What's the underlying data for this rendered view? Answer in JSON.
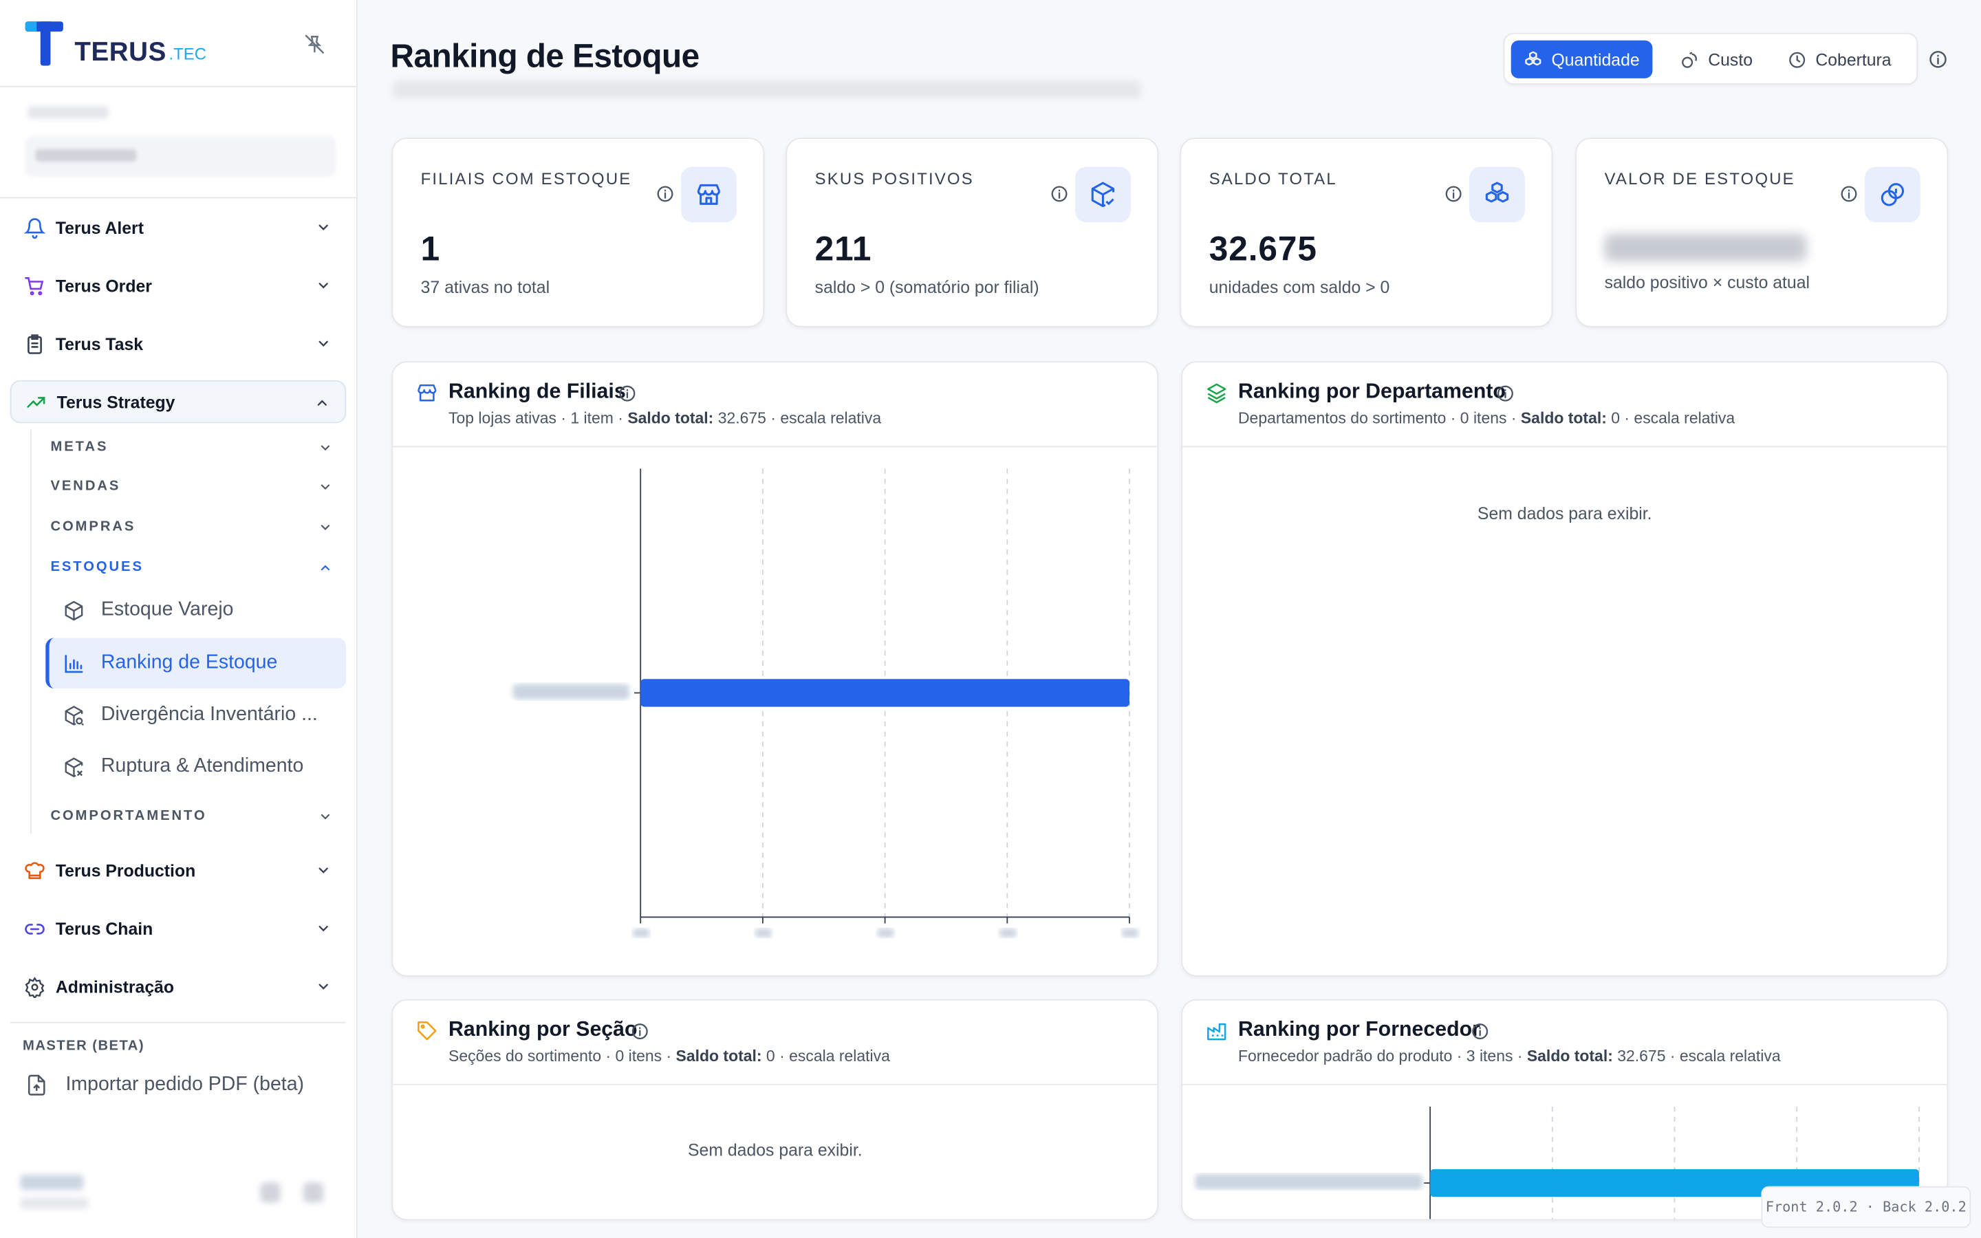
{
  "brand": {
    "name": "TERUS",
    "suffix": ".TEC"
  },
  "sidebar": {
    "nav": [
      {
        "label": "Terus Alert",
        "icon": "bell-icon"
      },
      {
        "label": "Terus Order",
        "icon": "cart-icon"
      },
      {
        "label": "Terus Task",
        "icon": "clipboard-icon"
      },
      {
        "label": "Terus Strategy",
        "icon": "trending-up-icon"
      },
      {
        "label": "Terus Production",
        "icon": "chef-hat-icon"
      },
      {
        "label": "Terus Chain",
        "icon": "link-icon"
      },
      {
        "label": "Administração",
        "icon": "gear-icon"
      }
    ],
    "strategy_sub": [
      {
        "label": "METAS"
      },
      {
        "label": "VENDAS"
      },
      {
        "label": "COMPRAS"
      },
      {
        "label": "ESTOQUES"
      },
      {
        "label": "COMPORTAMENTO"
      }
    ],
    "estoques_items": [
      {
        "label": "Estoque Varejo",
        "icon": "box-icon"
      },
      {
        "label": "Ranking de Estoque",
        "icon": "bar-chart-icon"
      },
      {
        "label": "Divergência Inventário ...",
        "icon": "box-search-icon"
      },
      {
        "label": "Ruptura & Atendimento",
        "icon": "box-x-icon"
      }
    ],
    "master_label": "MASTER (BETA)",
    "import_label": "Importar pedido PDF (beta)"
  },
  "header": {
    "title": "Ranking de Estoque",
    "toggle": [
      {
        "label": "Quantidade",
        "icon": "boxes-icon",
        "active": true
      },
      {
        "label": "Custo",
        "icon": "coins-icon",
        "active": false
      },
      {
        "label": "Cobertura",
        "icon": "clock-icon",
        "active": false
      }
    ]
  },
  "kpis": [
    {
      "label": "FILIAIS COM ESTOQUE",
      "value": "1",
      "sub": "37 ativas no total",
      "icon": "store-icon"
    },
    {
      "label": "SKUS POSITIVOS",
      "value": "211",
      "sub": "saldo > 0 (somatório por filial)",
      "icon": "package-check-icon"
    },
    {
      "label": "SALDO TOTAL",
      "value": "32.675",
      "sub": "unidades com saldo > 0",
      "icon": "boxes-icon"
    },
    {
      "label": "VALOR DE ESTOQUE",
      "value": "",
      "sub": "saldo positivo × custo atual",
      "icon": "coins-icon"
    }
  ],
  "cards": {
    "filiais": {
      "title": "Ranking de Filiais",
      "sub_pre": "Top lojas ativas · 1 item · ",
      "sub_bold": "Saldo total:",
      "sub_post": " 32.675 · escala relativa"
    },
    "departamento": {
      "title": "Ranking por Departamento",
      "sub_pre": "Departamentos do sortimento · 0 itens · ",
      "sub_bold": "Saldo total:",
      "sub_post": " 0 · escala relativa",
      "empty": "Sem dados para exibir."
    },
    "secao": {
      "title": "Ranking por Seção",
      "sub_pre": "Seções do sortimento · 0 itens · ",
      "sub_bold": "Saldo total:",
      "sub_post": " 0 · escala relativa",
      "empty": "Sem dados para exibir."
    },
    "fornecedor": {
      "title": "Ranking por Fornecedor",
      "sub_pre": "Fornecedor padrão do produto · 3 itens · ",
      "sub_bold": "Saldo total:",
      "sub_post": " 32.675 · escala relativa"
    }
  },
  "chart_data": [
    {
      "type": "bar",
      "orientation": "horizontal",
      "series": [
        {
          "values": [
            32675
          ]
        }
      ],
      "bar_fraction_of_axis": [
        1.0
      ],
      "grid": true,
      "bar_color": "#2563eb"
    },
    {
      "type": "bar",
      "orientation": "horizontal",
      "series": [
        {
          "values": [
            32675
          ]
        }
      ],
      "grid": true,
      "bar_color": "#0ea5e9"
    }
  ],
  "version": "Front 2.0.2 · Back 2.0.2",
  "colors": {
    "accent": "#2563eb",
    "sky": "#0ea5e9",
    "green": "#16a34a",
    "amber": "#f59e0b",
    "orange": "#ea580c",
    "violet": "#7c3aed"
  }
}
